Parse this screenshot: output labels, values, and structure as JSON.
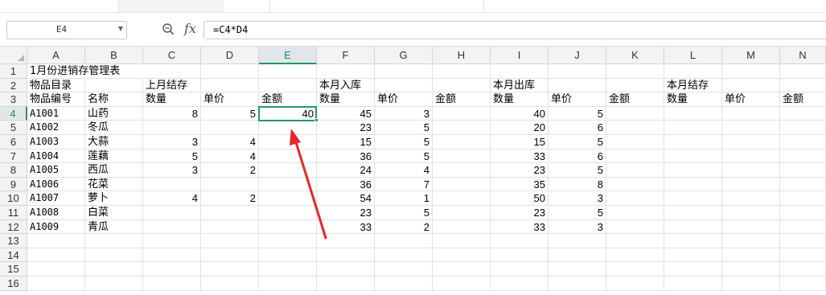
{
  "formula_bar": {
    "name_box": "E4",
    "fx_label": "fx",
    "formula": "=C4*D4"
  },
  "columns": [
    "A",
    "B",
    "C",
    "D",
    "E",
    "F",
    "G",
    "H",
    "I",
    "J",
    "K",
    "L",
    "M",
    "N"
  ],
  "selected_column": "E",
  "rows": [
    "1",
    "2",
    "3",
    "4",
    "5",
    "6",
    "7",
    "8",
    "9",
    "10",
    "11",
    "12",
    "13",
    "14",
    "15",
    "16"
  ],
  "selected_row": "4",
  "sheet": {
    "title": "1月份进销存管理表",
    "row2": {
      "A": "物品目录",
      "C": "上月结存",
      "F": "本月入库",
      "I": "本月出库",
      "L": "本月结存"
    },
    "row3": {
      "A": "物品编号",
      "B": "名称",
      "C": "数量",
      "D": "单价",
      "E": "金额",
      "F": "数量",
      "G": "单价",
      "H": "金额",
      "I": "数量",
      "J": "单价",
      "K": "金额",
      "L": "数量",
      "M": "单价",
      "N": "金额"
    },
    "items": [
      {
        "code": "A1001",
        "name": "山药",
        "C": "8",
        "D": "5",
        "E": "40",
        "F": "45",
        "G": "3",
        "I": "40",
        "J": "5"
      },
      {
        "code": "A1002",
        "name": "冬瓜",
        "C": "",
        "D": "",
        "E": "",
        "F": "23",
        "G": "5",
        "I": "20",
        "J": "6"
      },
      {
        "code": "A1003",
        "name": "大蒜",
        "C": "3",
        "D": "4",
        "E": "",
        "F": "15",
        "G": "5",
        "I": "15",
        "J": "5"
      },
      {
        "code": "A1004",
        "name": "莲藕",
        "C": "5",
        "D": "4",
        "E": "",
        "F": "36",
        "G": "5",
        "I": "33",
        "J": "6"
      },
      {
        "code": "A1005",
        "name": "西瓜",
        "C": "3",
        "D": "2",
        "E": "",
        "F": "24",
        "G": "4",
        "I": "23",
        "J": "5"
      },
      {
        "code": "A1006",
        "name": "花菜",
        "C": "",
        "D": "",
        "E": "",
        "F": "36",
        "G": "7",
        "I": "35",
        "J": "8"
      },
      {
        "code": "A1007",
        "name": "萝卜",
        "C": "4",
        "D": "2",
        "E": "",
        "F": "54",
        "G": "1",
        "I": "50",
        "J": "3"
      },
      {
        "code": "A1008",
        "name": "白菜",
        "C": "",
        "D": "",
        "E": "",
        "F": "23",
        "G": "5",
        "I": "23",
        "J": "5"
      },
      {
        "code": "A1009",
        "name": "青瓜",
        "C": "",
        "D": "",
        "E": "",
        "F": "33",
        "G": "2",
        "I": "33",
        "J": "3"
      }
    ]
  },
  "annotation": {
    "arrow_color": "#e8262a",
    "selection_color": "#1e9b5e"
  }
}
